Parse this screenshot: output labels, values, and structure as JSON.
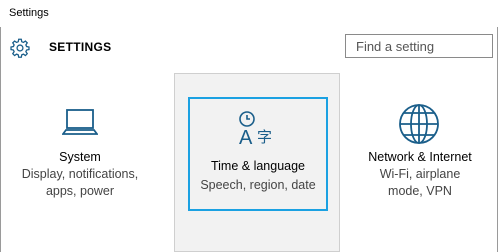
{
  "window": {
    "title": "Settings"
  },
  "header": {
    "title": "SETTINGS",
    "icon": "gear-icon",
    "search_placeholder": "Find a setting"
  },
  "tiles": [
    {
      "icon": "laptop-icon",
      "label": "System",
      "description": "Display, notifications, apps, power"
    },
    {
      "icon": "time-language-icon",
      "label": "Time & language",
      "description": "Speech, region, date",
      "selected": true
    },
    {
      "icon": "globe-icon",
      "label": "Network & Internet",
      "description": "Wi-Fi, airplane mode, VPN"
    }
  ],
  "colors": {
    "accent": "#1ba1e2",
    "icon": "#1a5e8a",
    "hover_bg": "#f2f2f2"
  }
}
